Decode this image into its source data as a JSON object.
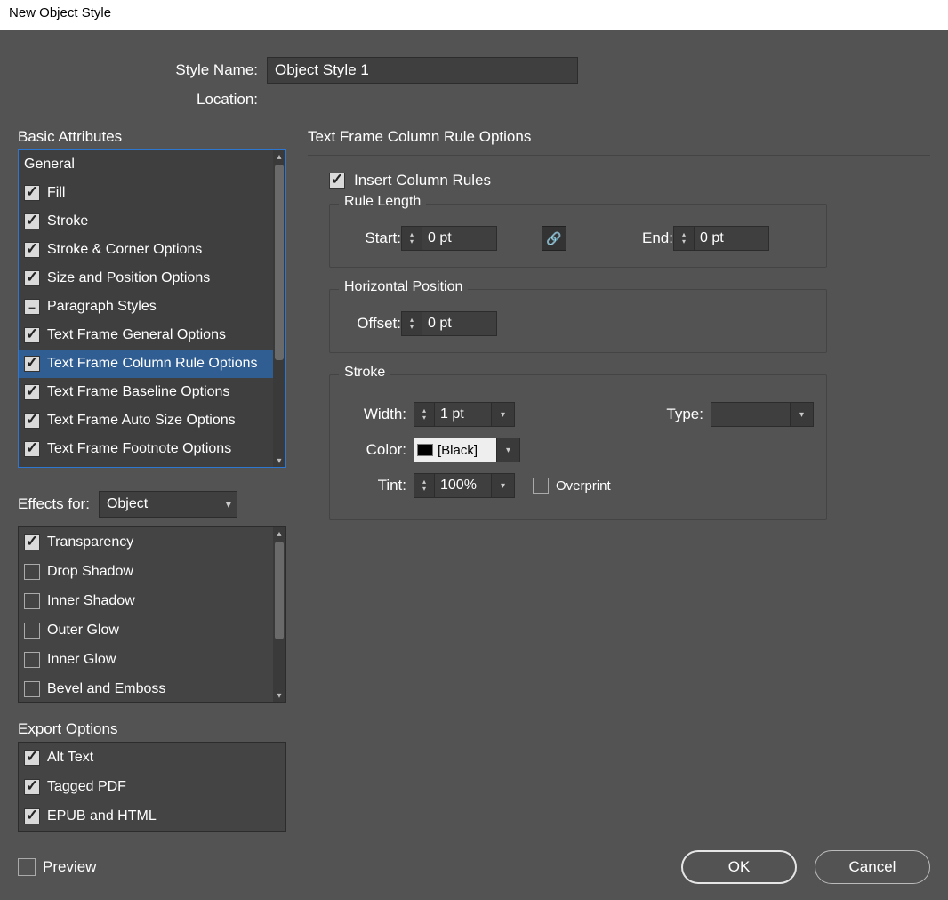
{
  "window_title": "New Object Style",
  "style_name_label": "Style Name:",
  "style_name_value": "Object Style 1",
  "location_label": "Location:",
  "basic_attributes_label": "Basic Attributes",
  "basic_attributes": [
    {
      "label": "General",
      "checked": null,
      "selected": false,
      "mixed": false
    },
    {
      "label": "Fill",
      "checked": true,
      "selected": false,
      "mixed": false
    },
    {
      "label": "Stroke",
      "checked": true,
      "selected": false,
      "mixed": false
    },
    {
      "label": "Stroke & Corner Options",
      "checked": true,
      "selected": false,
      "mixed": false
    },
    {
      "label": "Size and Position Options",
      "checked": true,
      "selected": false,
      "mixed": false
    },
    {
      "label": "Paragraph Styles",
      "checked": null,
      "selected": false,
      "mixed": true
    },
    {
      "label": "Text Frame General Options",
      "checked": true,
      "selected": false,
      "mixed": false
    },
    {
      "label": "Text Frame Column Rule Options",
      "checked": true,
      "selected": true,
      "mixed": false
    },
    {
      "label": "Text Frame Baseline Options",
      "checked": true,
      "selected": false,
      "mixed": false
    },
    {
      "label": "Text Frame Auto Size Options",
      "checked": true,
      "selected": false,
      "mixed": false
    },
    {
      "label": "Text Frame Footnote Options",
      "checked": true,
      "selected": false,
      "mixed": false
    }
  ],
  "effects_for_label": "Effects for:",
  "effects_for_value": "Object",
  "effects": [
    {
      "label": "Transparency",
      "checked": true
    },
    {
      "label": "Drop Shadow",
      "checked": false
    },
    {
      "label": "Inner Shadow",
      "checked": false
    },
    {
      "label": "Outer Glow",
      "checked": false
    },
    {
      "label": "Inner Glow",
      "checked": false
    },
    {
      "label": "Bevel and Emboss",
      "checked": false
    }
  ],
  "export_options_label": "Export Options",
  "export_options": [
    {
      "label": "Alt Text",
      "checked": true
    },
    {
      "label": "Tagged PDF",
      "checked": true
    },
    {
      "label": "EPUB and HTML",
      "checked": true
    }
  ],
  "options_title": "Text Frame Column Rule Options",
  "insert_column_rules_label": "Insert Column Rules",
  "insert_column_rules_checked": true,
  "rule_length_legend": "Rule Length",
  "start_label": "Start:",
  "start_value": "0 pt",
  "end_label": "End:",
  "end_value": "0 pt",
  "horizontal_position_legend": "Horizontal Position",
  "offset_label": "Offset:",
  "offset_value": "0 pt",
  "stroke_legend": "Stroke",
  "width_label": "Width:",
  "width_value": "1 pt",
  "type_label": "Type:",
  "type_value": "",
  "color_label": "Color:",
  "color_value": "[Black]",
  "tint_label": "Tint:",
  "tint_value": "100%",
  "overprint_label": "Overprint",
  "overprint_checked": false,
  "preview_label": "Preview",
  "preview_checked": false,
  "ok_label": "OK",
  "cancel_label": "Cancel",
  "colors": {
    "accent": "#2e77d0",
    "panel": "#535353"
  }
}
